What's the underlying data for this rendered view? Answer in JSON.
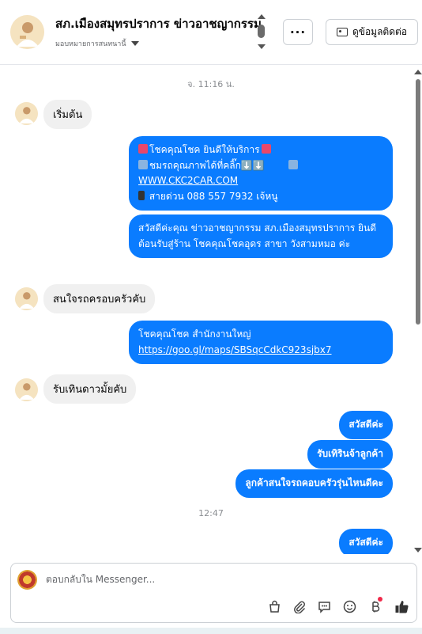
{
  "header": {
    "title": "สภ.เมืองสมุทรปราการ ข่าวอาชญากรรม",
    "subtitle": "มอบหมายการสนทนานี้",
    "more_label": "···",
    "contact_label": "ดูข้อมูลติดต่อ"
  },
  "messages": {
    "ts1": "จ. 11:16 น.",
    "m1": "เริ่มต้น",
    "m2_l1": "โชคคุณโชค ยินดีให้บริการ",
    "m2_l2": "ชมรถคุณภาพได้ที่คลิ๊ก⬇️⬇️",
    "m2_link": "WWW.CKC2CAR.COM",
    "m2_l4": "สายด่วน 088 557 7932 เจ้หนู",
    "m3": "สวัสดีค่ะคุณ ข่าวอาชญากรรม สภ.เมืองสมุทรปราการ ยินดีต้อนรับสู่ร้าน โชคคุณโชคอุดร สาขา วังสามหมอ ค่ะ",
    "m4": "สนใจรถครอบครัวคับ",
    "m5_l1": "โชคคุณโชค สำนักงานใหญ่",
    "m5_link": "https://goo.gl/maps/SBSqcCdkC923sjbx7",
    "m6": "รับเทินดาวมั้ยคับ",
    "m7": "สวัสดีค่ะ",
    "m8": "รับเทิรินจ้าลูกค้า",
    "m9": "ลูกค้าสนใจรถคอบครัวรุ่นไหนดีคะ",
    "ts2": "12:47",
    "m10": "สวัสดีค่ะ"
  },
  "composer": {
    "placeholder": "ตอบกลับใน Messenger...",
    "icons": [
      "bag-icon",
      "attachment-icon",
      "saved-reply-icon",
      "emoji-icon",
      "baht-icon",
      "like-icon"
    ]
  },
  "colors": {
    "outgoing": "#0a7cff",
    "incoming": "#f0f0f0"
  }
}
